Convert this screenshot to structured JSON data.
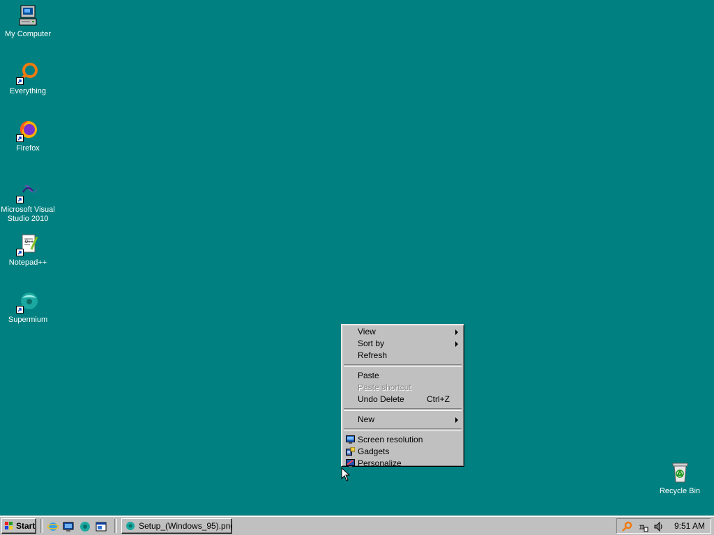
{
  "desktop": {
    "background": "#008080",
    "icons": [
      {
        "label": "My Computer",
        "icon": "my-computer-icon"
      },
      {
        "label": "Everything",
        "icon": "everything-search-icon"
      },
      {
        "label": "Firefox",
        "icon": "firefox-icon"
      },
      {
        "label_line1": "Microsoft Visual",
        "label_line2": "Studio 2010",
        "icon": "visual-studio-icon"
      },
      {
        "label": "Notepad++",
        "icon": "notepad-plus-plus-icon"
      },
      {
        "label": "Supermium",
        "icon": "supermium-icon"
      },
      {
        "label": "Recycle Bin",
        "icon": "recycle-bin-icon"
      }
    ]
  },
  "context_menu": {
    "view": "View",
    "sort_by": "Sort by",
    "refresh": "Refresh",
    "paste": "Paste",
    "paste_shortcut": "Paste shortcut",
    "undo_delete": "Undo Delete",
    "undo_shortcut": "Ctrl+Z",
    "new": "New",
    "screen_resolution": "Screen resolution",
    "gadgets": "Gadgets",
    "personalize": "Personalize"
  },
  "taskbar": {
    "start_label": "Start",
    "quick_launch": [
      "internet-explorer-icon",
      "show-desktop-icon",
      "supermium-icon",
      "window-switch-icon"
    ],
    "task_label": "Setup_(Windows_95).png...",
    "tray_icons": [
      "search-icon",
      "ime-icon",
      "volume-icon"
    ],
    "clock": "9:51 AM"
  }
}
